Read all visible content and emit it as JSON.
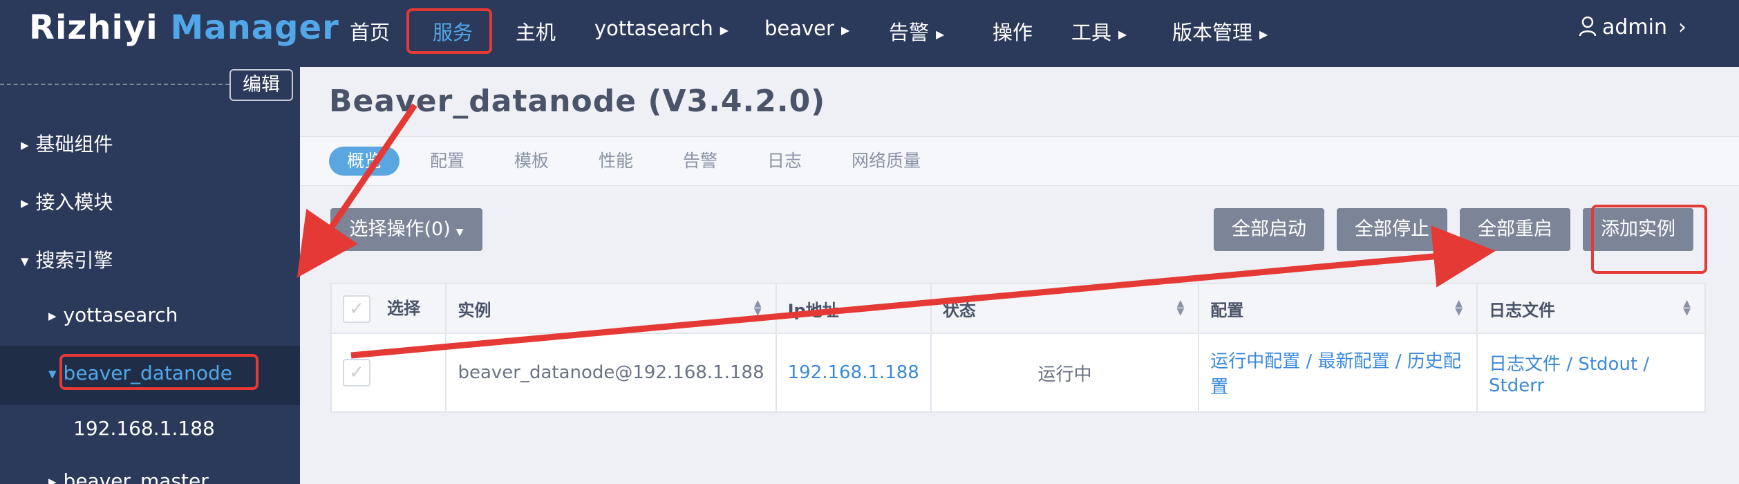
{
  "app": {
    "logo_main": "Rizhiyi",
    "logo_accent": "Manager"
  },
  "nav": {
    "items": [
      {
        "label": "首页",
        "caret": false
      },
      {
        "label": "服务",
        "caret": false,
        "active": true
      },
      {
        "label": "主机",
        "caret": false
      },
      {
        "label": "yottasearch",
        "caret": true
      },
      {
        "label": "beaver",
        "caret": true
      },
      {
        "label": "告警",
        "caret": true
      },
      {
        "label": "操作",
        "caret": false
      },
      {
        "label": "工具",
        "caret": true
      },
      {
        "label": "版本管理",
        "caret": true
      }
    ],
    "user": "admin"
  },
  "sidebar": {
    "edit_label": "编辑",
    "items": [
      {
        "label": "基础组件"
      },
      {
        "label": "接入模块"
      },
      {
        "label": "搜索引擎"
      },
      {
        "label": "yottasearch"
      },
      {
        "label": "beaver_datanode"
      },
      {
        "label": "192.168.1.188"
      },
      {
        "label": "beaver_master"
      }
    ]
  },
  "main": {
    "title": "Beaver_datanode (V3.4.2.0)",
    "tabs": [
      "概览",
      "配置",
      "模板",
      "性能",
      "告警",
      "日志",
      "网络质量"
    ],
    "select_ops_label": "选择操作(0)",
    "buttons": {
      "start_all": "全部启动",
      "stop_all": "全部停止",
      "restart_all": "全部重启",
      "add_instance": "添加实例"
    },
    "table": {
      "headers": [
        "选择",
        "实例",
        "Ip地址",
        "状态",
        "配置",
        "日志文件"
      ],
      "rows": [
        {
          "instance": "beaver_datanode@192.168.1.188",
          "ip": "192.168.1.188",
          "status": "运行中",
          "config_running": "运行中配置",
          "config_latest": "最新配置",
          "config_history": "历史配置",
          "log_file": "日志文件",
          "log_stdout": "Stdout",
          "log_stderr": "Stderr"
        }
      ]
    }
  },
  "colors": {
    "nav_bg": "#2b3a5a",
    "accent": "#52a7e8",
    "annotation_red": "#e53935",
    "running": "#38b59f"
  }
}
